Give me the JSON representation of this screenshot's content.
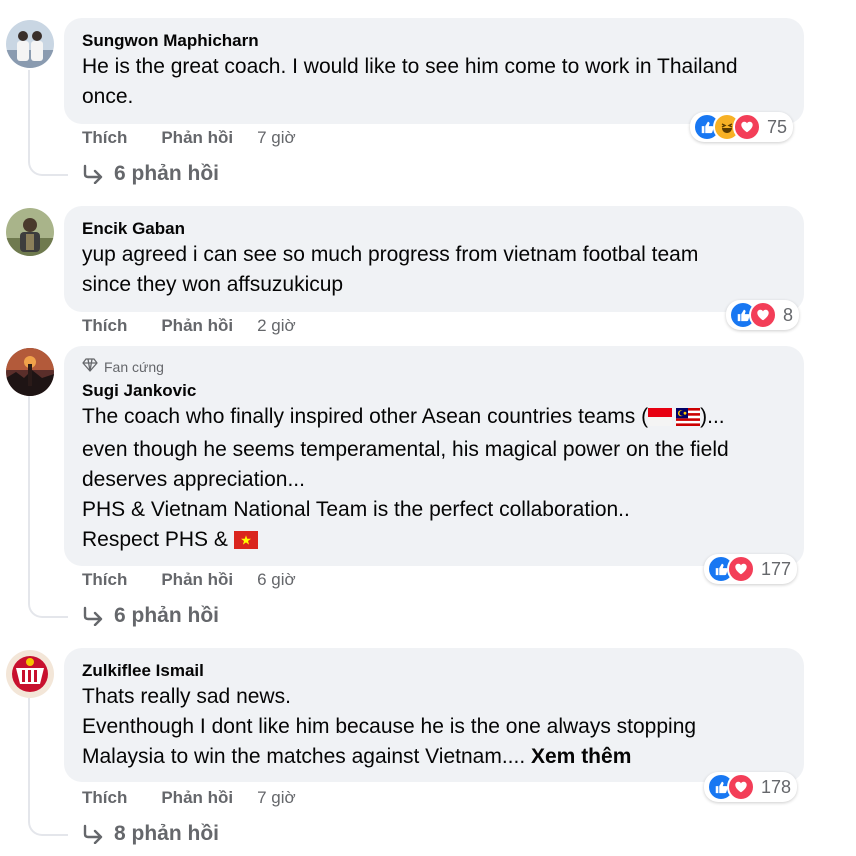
{
  "comments": [
    {
      "author": "Sungwon Maphicharn",
      "lines": [
        "He is the great coach. I would like to see him come to work in Thailand",
        "once."
      ],
      "like_label": "Thích",
      "reply_label": "Phản hồi",
      "time": "7 giờ",
      "reaction_count": "75",
      "replies_label": "6 phản hồi"
    },
    {
      "author": "Encik Gaban",
      "lines": [
        "yup agreed i can see so much progress from vietnam footbal team",
        "since they won affsuzukicup"
      ],
      "like_label": "Thích",
      "reply_label": "Phản hồi",
      "time": "2 giờ",
      "reaction_count": "8"
    },
    {
      "badge": "Fan cứng",
      "author": "Sugi Jankovic",
      "lines": [
        "The coach who finally inspired other Asean countries teams (",
        "even though he seems temperamental, his magical power on the field",
        "deserves appreciation...",
        "PHS & Vietnam National Team is the perfect collaboration..",
        "Respect PHS & "
      ],
      "line0_tail": ")...",
      "like_label": "Thích",
      "reply_label": "Phản hồi",
      "time": "6 giờ",
      "reaction_count": "177",
      "replies_label": "6 phản hồi"
    },
    {
      "author": "Zulkiflee Ismail",
      "lines": [
        "Thats really sad news.",
        "Eventhough I dont like him because he is the one always stopping",
        "Malaysia to win the matches against Vietnam.... "
      ],
      "see_more": "Xem thêm",
      "like_label": "Thích",
      "reply_label": "Phản hồi",
      "time": "7 giờ",
      "reaction_count": "178",
      "replies_label": "8 phản hồi"
    }
  ],
  "colors": {
    "bubble": "#f0f2f5",
    "secondary_text": "#65676b",
    "like_blue": "#1877f2",
    "love_red": "#f33e58",
    "haha_yellow": "#f7b125"
  }
}
